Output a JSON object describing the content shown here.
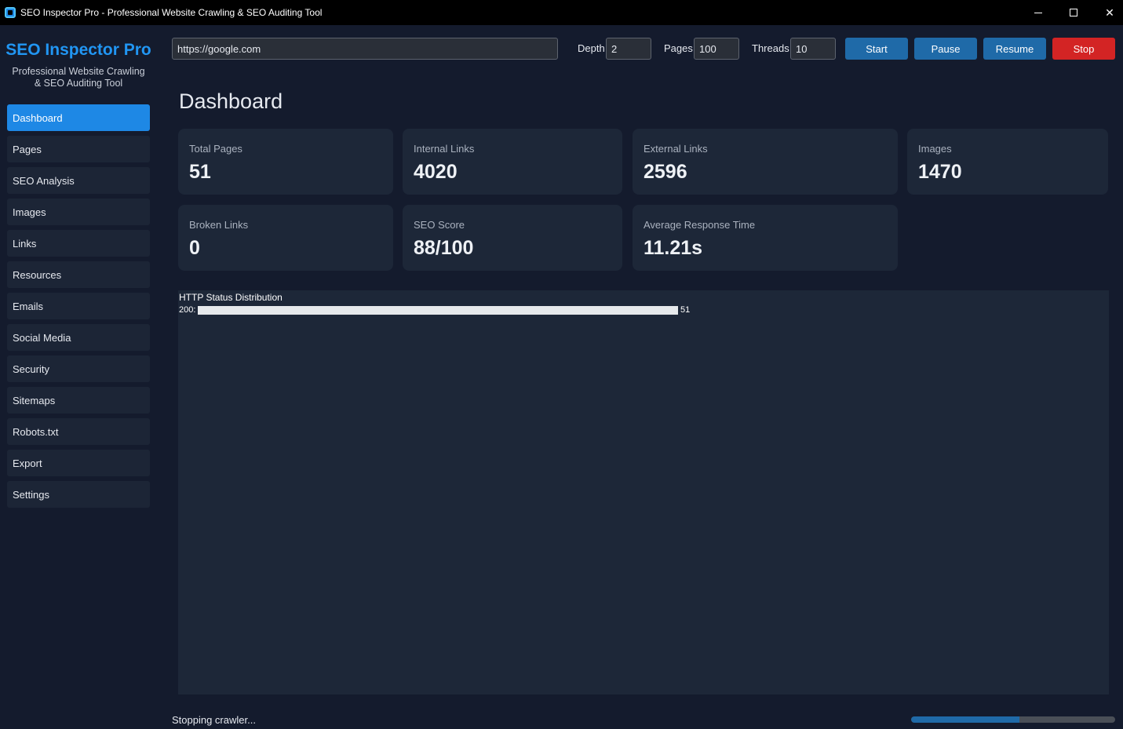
{
  "window": {
    "title": "SEO Inspector Pro - Professional Website Crawling & SEO Auditing Tool",
    "icon": "app-square-icon"
  },
  "sidebar": {
    "brand": "SEO Inspector Pro",
    "tagline_line1": "Professional Website Crawling",
    "tagline_line2": "& SEO Auditing Tool",
    "items": [
      {
        "label": "Dashboard",
        "active": true
      },
      {
        "label": "Pages"
      },
      {
        "label": "SEO Analysis"
      },
      {
        "label": "Images"
      },
      {
        "label": "Links"
      },
      {
        "label": "Resources"
      },
      {
        "label": "Emails"
      },
      {
        "label": "Social Media"
      },
      {
        "label": "Security"
      },
      {
        "label": "Sitemaps"
      },
      {
        "label": "Robots.txt"
      },
      {
        "label": "Export"
      },
      {
        "label": "Settings"
      }
    ]
  },
  "toolbar": {
    "url": "https://google.com",
    "depth_label": "Depth",
    "depth_value": "2",
    "pages_label": "Pages",
    "pages_value": "100",
    "threads_label": "Threads",
    "threads_value": "10",
    "start_label": "Start",
    "pause_label": "Pause",
    "resume_label": "Resume",
    "stop_label": "Stop"
  },
  "main": {
    "title": "Dashboard",
    "cards": [
      {
        "label": "Total Pages",
        "value": "51"
      },
      {
        "label": "Internal Links",
        "value": "4020"
      },
      {
        "label": "External Links",
        "value": "2596"
      },
      {
        "label": "Images",
        "value": "1470"
      },
      {
        "label": "Broken Links",
        "value": "0"
      },
      {
        "label": "SEO Score",
        "value": "88/100"
      },
      {
        "label": "Average Response Time",
        "value": "11.21s"
      }
    ]
  },
  "chart_data": {
    "type": "bar",
    "title": "HTTP Status Distribution",
    "categories": [
      "200"
    ],
    "values": [
      51
    ],
    "max": 51,
    "bar_color": "#e6e9ec"
  },
  "status": {
    "text": "Stopping crawler...",
    "progress": 0.53
  },
  "colors": {
    "accent": "#1e88e5",
    "brand": "#2196f3",
    "stop": "#d32424",
    "card_bg": "#1d2738",
    "page_bg": "#141b2d"
  }
}
